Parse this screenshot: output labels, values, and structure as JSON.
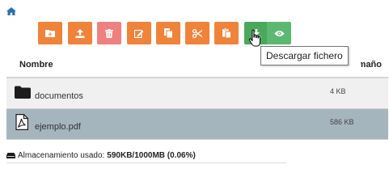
{
  "toolbar": {
    "buttons": [
      {
        "icon": "new-folder-icon",
        "color": "#f0833a"
      },
      {
        "icon": "upload-icon",
        "color": "#f0833a"
      },
      {
        "icon": "trash-icon",
        "color": "#f08080"
      },
      {
        "icon": "edit-icon",
        "color": "#f0833a"
      },
      {
        "icon": "copy-icon",
        "color": "#f0833a"
      },
      {
        "icon": "scissors-icon",
        "color": "#f0833a"
      },
      {
        "icon": "paste-icon",
        "color": "#f0833a"
      },
      {
        "icon": "download-icon",
        "color": "#49a85c"
      },
      {
        "icon": "eye-icon",
        "color": "#5cb86f"
      }
    ]
  },
  "tooltip": {
    "text": "Descargar fichero"
  },
  "table": {
    "headers": {
      "name": "Nombre",
      "size": "Tamaño"
    },
    "rows": [
      {
        "name": "documentos",
        "size": "4 KB",
        "icon": "folder-icon"
      },
      {
        "name": "ejemplo.pdf",
        "size": "586 KB",
        "icon": "pdf-file-icon"
      }
    ]
  },
  "storage": {
    "label": "Almacenamiento usado:",
    "value": "590KB/1000MB (0.06%)"
  },
  "colors": {
    "accent_orange": "#f0833a",
    "danger": "#f08080",
    "success": "#49a85c",
    "selected_row": "#a5b5be"
  }
}
